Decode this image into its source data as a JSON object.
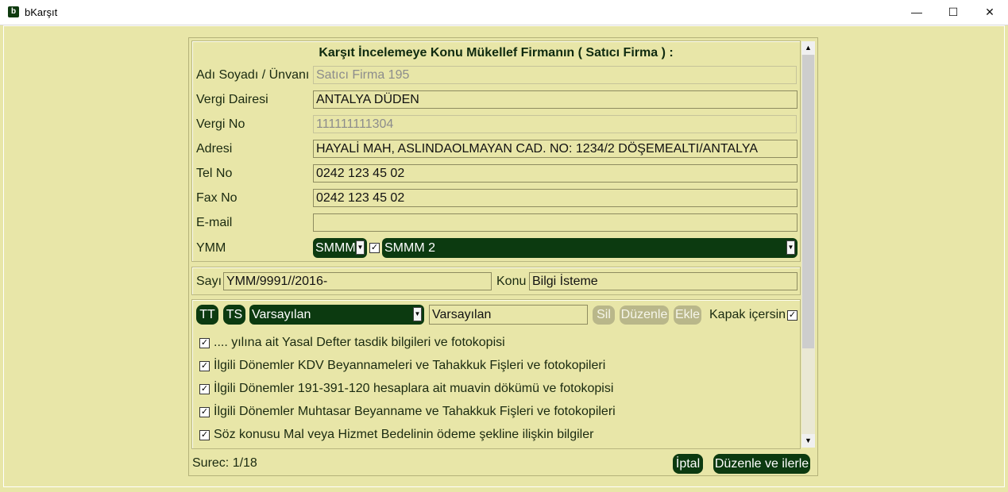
{
  "window": {
    "title": "bKarşıt",
    "icon": "b",
    "controls": {
      "minimize": "—",
      "maximize": "☐",
      "close": "✕"
    }
  },
  "form": {
    "heading": "Karşıt İncelemeye Konu Mükellef Firmanın ( Satıcı Firma ) :",
    "fields": {
      "name": {
        "label": "Adı Soyadı / Ünvanı",
        "value": "Satıcı Firma 195"
      },
      "tax_office": {
        "label": "Vergi Dairesi",
        "value": "ANTALYA DÜDEN"
      },
      "tax_no": {
        "label": "Vergi No",
        "value": "111111111304"
      },
      "address": {
        "label": "Adresi",
        "value": "HAYALİ MAH, ASLINDAOLMAYAN CAD. NO: 1234/2 DÖŞEMEALTI/ANTALYA"
      },
      "tel": {
        "label": "Tel No",
        "value": "0242 123 45 02"
      },
      "fax": {
        "label": "Fax No",
        "value": "0242 123 45 02"
      },
      "email": {
        "label": "E-mail",
        "value": ""
      },
      "ymm": {
        "label": "YMM",
        "type_value": "SMMM",
        "checkbox_checked": true,
        "name_value": "SMMM 2"
      }
    },
    "sayi": {
      "label": "Sayı",
      "value": "YMM/9991//2016-"
    },
    "konu": {
      "label": "Konu",
      "value": "Bilgi İsteme"
    }
  },
  "templates": {
    "tt_button": "TT",
    "ts_button": "TS",
    "select_value": "Varsayılan",
    "name_value": "Varsayılan",
    "delete_button": "Sil",
    "edit_button": "Düzenle",
    "add_button": "Ekle",
    "cover_label": "Kapak içersin",
    "cover_checked": true,
    "items": [
      {
        "text": ".... yılına ait Yasal Defter tasdik bilgileri ve fotokopisi",
        "checked": true
      },
      {
        "text": "İlgili Dönemler KDV Beyannameleri ve Tahakkuk Fişleri ve fotokopileri",
        "checked": true
      },
      {
        "text": "İlgili Dönemler 191-391-120 hesaplara ait muavin dökümü ve fotokopisi",
        "checked": true
      },
      {
        "text": "İlgili Dönemler Muhtasar Beyanname ve Tahakkuk Fişleri ve fotokopileri",
        "checked": true
      },
      {
        "text": "Söz konusu Mal veya Hizmet Bedelinin ödeme şekline ilişkin bilgiler",
        "checked": true
      }
    ]
  },
  "footer": {
    "status": "Surec: 1/18",
    "cancel_button": "İptal",
    "next_button": "Düzenle ve ilerle"
  },
  "icons": {
    "dropdown_arrow": "▼",
    "checkmark": "✓",
    "scroll_up": "▲",
    "scroll_down": "▼"
  }
}
